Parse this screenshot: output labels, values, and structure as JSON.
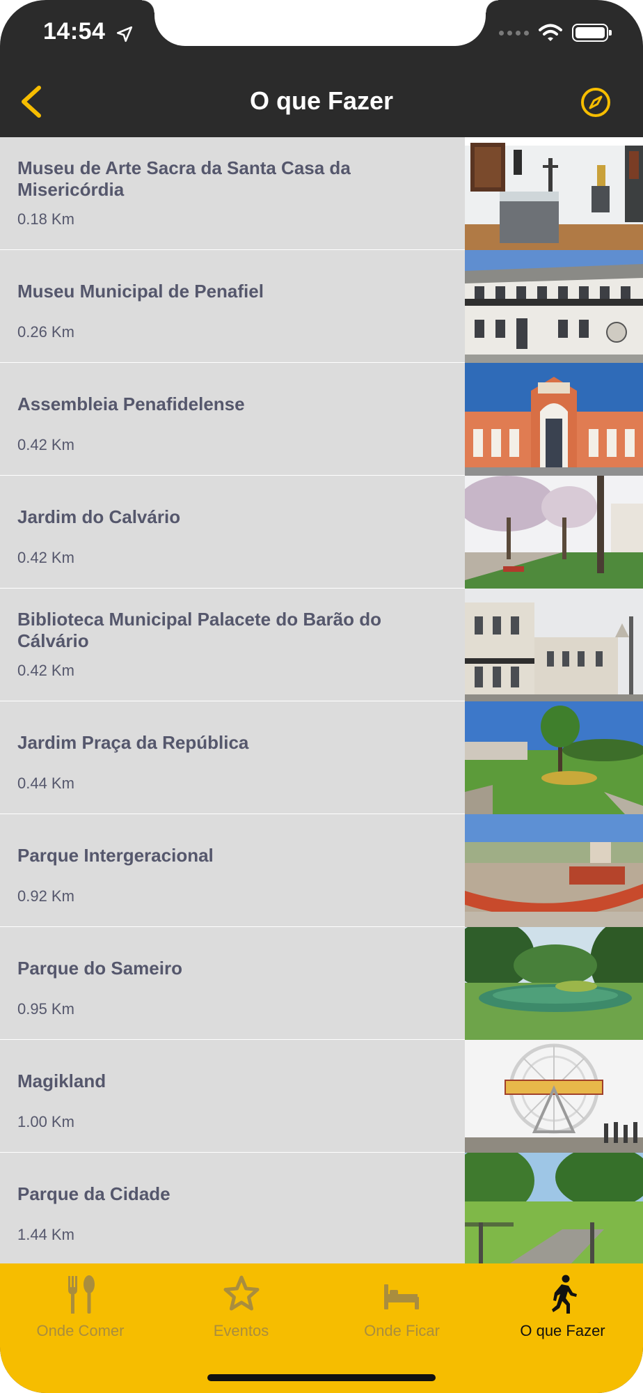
{
  "status_bar": {
    "time": "14:54"
  },
  "nav": {
    "title": "O que Fazer",
    "accent_color": "#f6bd00"
  },
  "places": [
    {
      "name": "Museu de Arte Sacra da Santa Casa da Misericórdia",
      "distance": "0.18 Km"
    },
    {
      "name": "Museu Municipal de Penafiel",
      "distance": "0.26 Km"
    },
    {
      "name": "Assembleia Penafidelense",
      "distance": "0.42 Km"
    },
    {
      "name": "Jardim do Calvário",
      "distance": "0.42 Km"
    },
    {
      "name": "Biblioteca Municipal Palacete do Barão do Cálvário",
      "distance": "0.42 Km"
    },
    {
      "name": "Jardim Praça da República",
      "distance": "0.44 Km"
    },
    {
      "name": "Parque Intergeracional",
      "distance": "0.92 Km"
    },
    {
      "name": "Parque do Sameiro",
      "distance": "0.95 Km"
    },
    {
      "name": "Magikland",
      "distance": "1.00 Km"
    },
    {
      "name": "Parque da Cidade",
      "distance": "1.44 Km"
    }
  ],
  "tabbar": {
    "tabs": [
      {
        "label": "Onde Comer",
        "icon": "fork-spoon-icon"
      },
      {
        "label": "Eventos",
        "icon": "star-icon"
      },
      {
        "label": "Onde Ficar",
        "icon": "bed-icon"
      },
      {
        "label": "O que Fazer",
        "icon": "walking-person-icon"
      }
    ],
    "active_index": 3,
    "background_color": "#f6bd00"
  }
}
